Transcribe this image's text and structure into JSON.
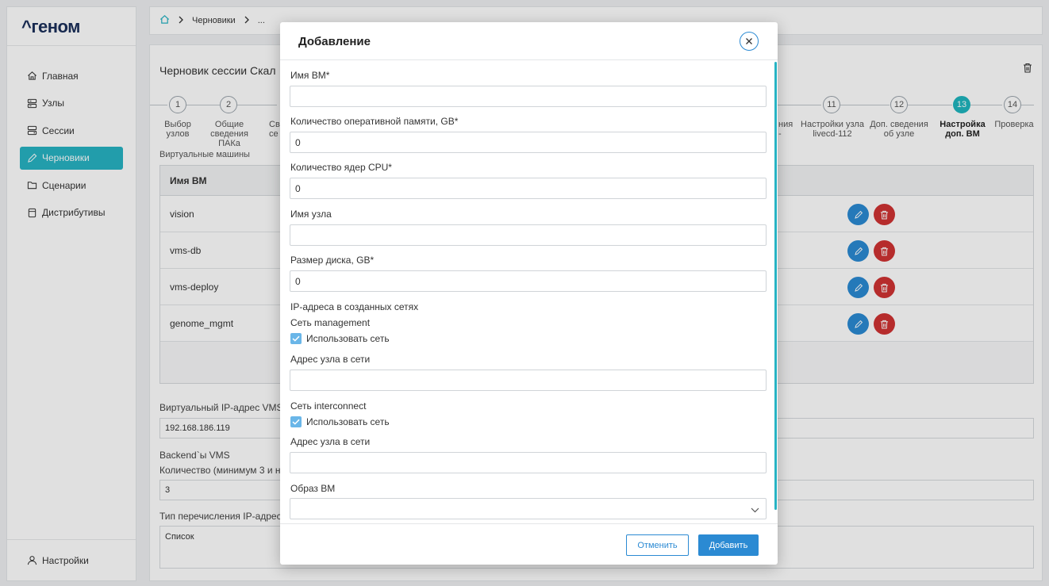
{
  "app": {
    "logo": "^геном",
    "nav": [
      {
        "label": "Главная"
      },
      {
        "label": "Узлы"
      },
      {
        "label": "Сессии"
      },
      {
        "label": "Черновики"
      },
      {
        "label": "Сценарии"
      },
      {
        "label": "Дистрибутивы"
      }
    ],
    "settings_label": "Настройки",
    "active_nav": "Черновики",
    "accent_color": "#27b3c3"
  },
  "breadcrumb": {
    "home_icon": "home-icon",
    "items": [
      "Черновики",
      "..."
    ]
  },
  "session": {
    "title": "Черновик сессии Скал",
    "steps": [
      {
        "number": "1",
        "label": "Выбор\nузлов"
      },
      {
        "number": "2",
        "label": "Общие\nсведения ПАКа"
      },
      {
        "number": "11",
        "label": "Настройки узла\nlivecd-112"
      },
      {
        "number": "12",
        "label": "Доп. сведения\nоб узле"
      },
      {
        "number": "13",
        "label": "Настройка\nдоп. ВМ"
      },
      {
        "number": "14",
        "label": "Проверка"
      }
    ],
    "step_partial_left": "Св\nсе",
    "step_partial_right": "ния\n-",
    "vm_section_label": "Виртуальные машины",
    "vm_table": {
      "header": "Имя ВМ",
      "rows": [
        "vision",
        "vms-db",
        "vms-deploy",
        "genome_mgmt"
      ]
    },
    "virtual_ip_label": "Виртуальный IP-адрес VMS",
    "virtual_ip_value": "192.168.186.119",
    "backends_label": "Backend`ы VMS",
    "count_label": "Количество (минимум 3 и не",
    "count_value": "3",
    "ip_enum_label": "Тип перечисления IP-адресо",
    "ip_enum_value": "Список"
  },
  "modal": {
    "title": "Добавление",
    "fields": {
      "vm_name": {
        "label": "Имя ВМ*",
        "value": ""
      },
      "ram": {
        "label": "Количество оперативной памяти, GB*",
        "value": "0"
      },
      "cpu": {
        "label": "Количество ядер CPU*",
        "value": "0"
      },
      "node_name": {
        "label": "Имя узла",
        "value": ""
      },
      "disk": {
        "label": "Размер диска, GB*",
        "value": "0"
      }
    },
    "ip_section_label": "IP-адреса в созданных сетях",
    "networks": [
      {
        "name": "Сеть management",
        "use_label": "Использовать сеть",
        "checked": true,
        "address_label": "Адрес узла в сети",
        "address_value": ""
      },
      {
        "name": "Сеть interconnect",
        "use_label": "Использовать сеть",
        "checked": true,
        "address_label": "Адрес узла в сети",
        "address_value": ""
      }
    ],
    "image": {
      "label": "Образ ВМ",
      "value": ""
    },
    "cancel_label": "Отменить",
    "add_label": "Добавить"
  }
}
